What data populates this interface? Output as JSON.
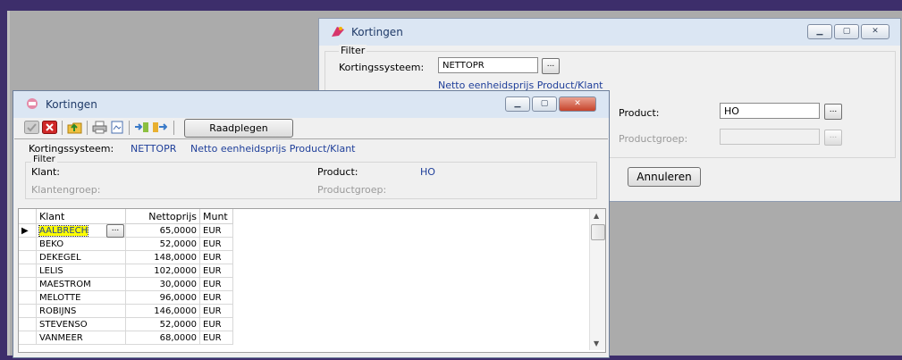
{
  "back_window": {
    "title": "Kortingen",
    "filter_label": "Filter",
    "kortingssysteem_label": "Kortingssysteem:",
    "kortingssysteem_value": "NETTOPR",
    "kortingssysteem_desc": "Netto eenheidsprijs  Product/Klant",
    "product_label": "Product:",
    "product_value": "HO",
    "productgroep_label": "Productgroep:",
    "productgroep_value": "",
    "cancel_label": "Annuleren",
    "lookup_label": "..."
  },
  "front_window": {
    "title": "Kortingen",
    "toolbar_button_label": "Raadplegen",
    "kortingssysteem_label": "Kortingssysteem:",
    "kortingssysteem_value": "NETTOPR",
    "kortingssysteem_desc": "Netto eenheidsprijs  Product/Klant",
    "filter_label": "Filter",
    "klant_label": "Klant:",
    "klantengroep_label": "Klantengroep:",
    "product_label": "Product:",
    "product_value": "HO",
    "productgroep_label": "Productgroep:",
    "lookup_label": "..."
  },
  "table": {
    "columns": [
      "Klant",
      "Nettoprijs",
      "Munt"
    ],
    "rows": [
      {
        "klant": "AALBRECH",
        "prijs": "65,0000",
        "munt": "EUR"
      },
      {
        "klant": "BEKO",
        "prijs": "52,0000",
        "munt": "EUR"
      },
      {
        "klant": "DEKEGEL",
        "prijs": "148,0000",
        "munt": "EUR"
      },
      {
        "klant": "LELIS",
        "prijs": "102,0000",
        "munt": "EUR"
      },
      {
        "klant": "MAESTROM",
        "prijs": "30,0000",
        "munt": "EUR"
      },
      {
        "klant": "MELOTTE",
        "prijs": "96,0000",
        "munt": "EUR"
      },
      {
        "klant": "ROBIJNS",
        "prijs": "146,0000",
        "munt": "EUR"
      },
      {
        "klant": "STEVENSO",
        "prijs": "52,0000",
        "munt": "EUR"
      },
      {
        "klant": "VANMEER",
        "prijs": "68,0000",
        "munt": "EUR"
      }
    ]
  },
  "colors": {
    "desktop": "#ababab",
    "titlebar": "#dbe6f3",
    "accent_blue": "#1f3f9a",
    "selected_cell": "#ffff00"
  }
}
